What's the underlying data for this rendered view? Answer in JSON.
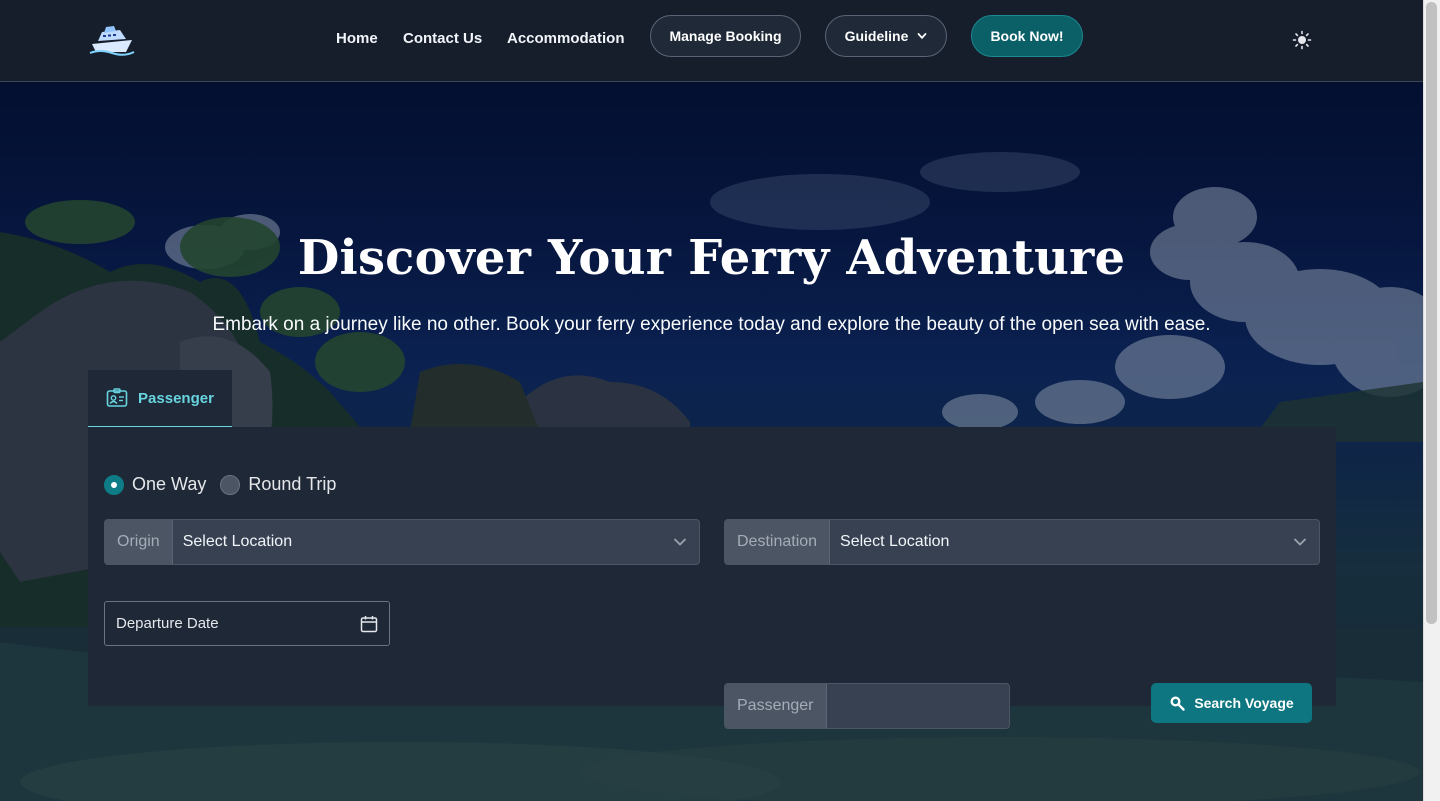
{
  "nav": {
    "links": [
      "Home",
      "Contact Us",
      "Accommodation"
    ],
    "manage_booking": "Manage Booking",
    "guideline": "Guideline",
    "book_now": "Book Now!"
  },
  "hero": {
    "title": "Discover Your Ferry Adventure",
    "subtitle": "Embark on a journey like no other. Book your ferry experience today and explore the beauty of the open sea with ease."
  },
  "search": {
    "tab_label": "Passenger",
    "trip_types": [
      "One Way",
      "Round Trip"
    ],
    "selected_trip_type": "One Way",
    "origin_label": "Origin",
    "origin_value": "Select Location",
    "destination_label": "Destination",
    "destination_value": "Select Location",
    "departure_date_placeholder": "Departure Date",
    "passenger_label": "Passenger",
    "passenger_value": "",
    "search_button": "Search Voyage"
  },
  "colors": {
    "accent": "#0e7680",
    "accent_light": "#67d4e0",
    "header_bg": "#161e2c",
    "card_bg": "#1f2836"
  },
  "icons": {
    "logo": "ferry-logo",
    "theme": "sun-icon",
    "tab": "id-card-icon",
    "date": "calendar-icon",
    "search": "search-icon",
    "select": "chevron-down-icon"
  }
}
